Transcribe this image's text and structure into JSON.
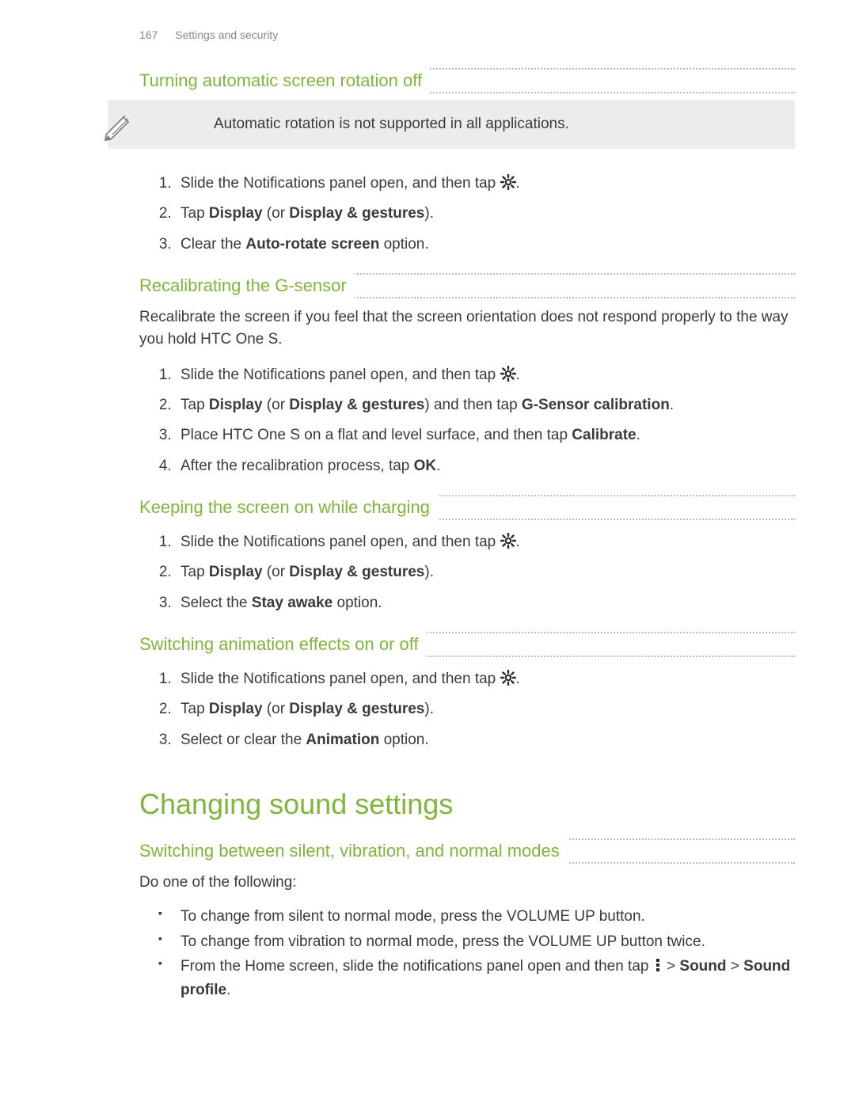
{
  "header": {
    "page_number": "167",
    "breadcrumb": "Settings and security"
  },
  "sections": [
    {
      "heading": "Turning automatic screen rotation off",
      "note": "Automatic rotation is not supported in all applications.",
      "steps": [
        {
          "pre": "Slide the Notifications panel open, and then tap ",
          "icon": "settings-gear-icon",
          "post": "."
        },
        {
          "parts": [
            "Tap ",
            {
              "b": "Display"
            },
            " (or ",
            {
              "b": "Display & gestures"
            },
            ")."
          ]
        },
        {
          "parts": [
            "Clear the ",
            {
              "b": "Auto-rotate screen"
            },
            " option."
          ]
        }
      ]
    },
    {
      "heading": "Recalibrating the G-sensor",
      "intro": "Recalibrate the screen if you feel that the screen orientation does not respond properly to the way you hold HTC One S.",
      "steps": [
        {
          "pre": "Slide the Notifications panel open, and then tap ",
          "icon": "settings-gear-icon",
          "post": "."
        },
        {
          "parts": [
            "Tap ",
            {
              "b": "Display"
            },
            " (or ",
            {
              "b": "Display & gestures"
            },
            ") and then tap ",
            {
              "b": "G-Sensor calibration"
            },
            "."
          ]
        },
        {
          "parts": [
            "Place HTC One S on a flat and level surface, and then tap ",
            {
              "b": "Calibrate"
            },
            "."
          ]
        },
        {
          "parts": [
            "After the recalibration process, tap ",
            {
              "b": "OK"
            },
            "."
          ]
        }
      ]
    },
    {
      "heading": "Keeping the screen on while charging",
      "steps": [
        {
          "pre": "Slide the Notifications panel open, and then tap ",
          "icon": "settings-gear-icon",
          "post": "."
        },
        {
          "parts": [
            "Tap ",
            {
              "b": "Display"
            },
            " (or ",
            {
              "b": "Display & gestures"
            },
            ")."
          ]
        },
        {
          "parts": [
            "Select the ",
            {
              "b": "Stay awake"
            },
            " option."
          ]
        }
      ]
    },
    {
      "heading": "Switching animation effects on or off",
      "steps": [
        {
          "pre": "Slide the Notifications panel open, and then tap ",
          "icon": "settings-gear-icon",
          "post": "."
        },
        {
          "parts": [
            "Tap ",
            {
              "b": "Display"
            },
            " (or ",
            {
              "b": "Display & gestures"
            },
            ")."
          ]
        },
        {
          "parts": [
            "Select or clear the ",
            {
              "b": "Animation"
            },
            " option."
          ]
        }
      ]
    }
  ],
  "major_heading": "Changing sound settings",
  "sound_section": {
    "heading": "Switching between silent, vibration, and normal modes",
    "intro": "Do one of the following:",
    "bullets": [
      {
        "parts": [
          "To change from silent to normal mode, press the VOLUME UP button."
        ]
      },
      {
        "parts": [
          "To change from vibration to normal mode, press the VOLUME UP button twice."
        ]
      },
      {
        "pre": "From the Home screen, slide the notifications panel open and then tap ",
        "icon": "more-vertical-icon",
        "post_parts": [
          " > ",
          {
            "b": "Sound"
          },
          " > ",
          {
            "b": "Sound profile"
          },
          "."
        ]
      }
    ]
  },
  "icons": {
    "settings_gear": "settings-gear-icon",
    "more_vertical": "more-vertical-icon"
  }
}
